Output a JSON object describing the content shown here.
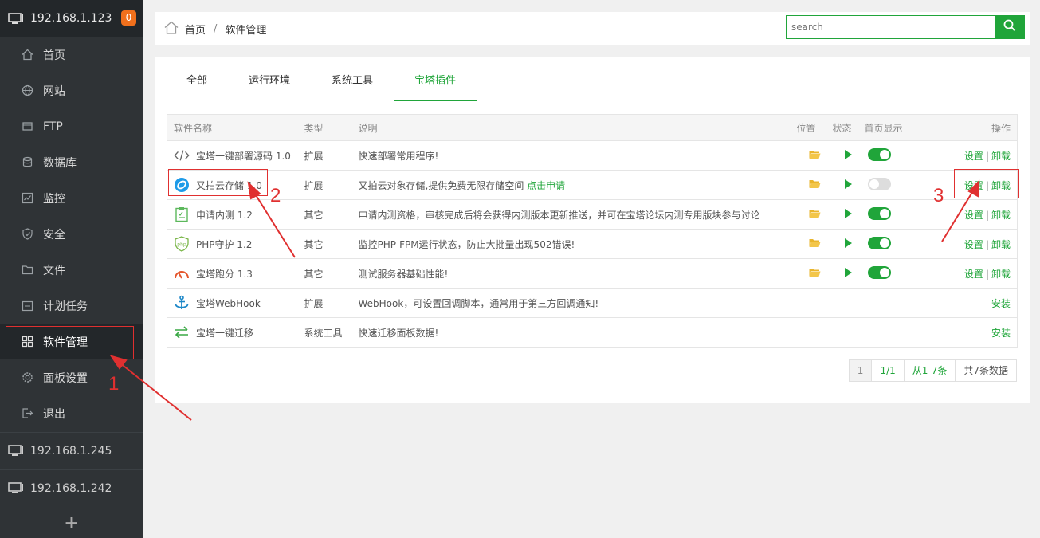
{
  "sidebar": {
    "server": "192.168.1.123",
    "badge": "0",
    "items": [
      {
        "label": "首页",
        "icon": "home-icon"
      },
      {
        "label": "网站",
        "icon": "globe-icon"
      },
      {
        "label": "FTP",
        "icon": "ftp-icon"
      },
      {
        "label": "数据库",
        "icon": "database-icon"
      },
      {
        "label": "监控",
        "icon": "monitor-chart-icon"
      },
      {
        "label": "安全",
        "icon": "shield-icon"
      },
      {
        "label": "文件",
        "icon": "folder-icon"
      },
      {
        "label": "计划任务",
        "icon": "calendar-icon"
      },
      {
        "label": "软件管理",
        "icon": "grid-icon"
      },
      {
        "label": "面板设置",
        "icon": "gear-icon"
      },
      {
        "label": "退出",
        "icon": "logout-icon"
      }
    ],
    "other_servers": [
      "192.168.1.245",
      "192.168.1.242"
    ],
    "add_label": "+"
  },
  "breadcrumb": {
    "home": "首页",
    "sep": "/",
    "current": "软件管理"
  },
  "search": {
    "placeholder": "search"
  },
  "tabs": [
    "全部",
    "运行环境",
    "系统工具",
    "宝塔插件"
  ],
  "table": {
    "headers": {
      "name": "软件名称",
      "type": "类型",
      "desc": "说明",
      "pos": "位置",
      "status": "状态",
      "show": "首页显示",
      "op": "操作"
    },
    "rows": [
      {
        "name": "宝塔一键部署源码 1.0",
        "icon": "code-icon",
        "type": "扩展",
        "desc": "快速部署常用程序!",
        "link": "",
        "installed": true,
        "show": true,
        "op1": "设置",
        "op2": "卸载"
      },
      {
        "name": "又拍云存储 1.0",
        "icon": "upyun-icon",
        "type": "扩展",
        "desc": "又拍云对象存储,提供免费无限存储空间",
        "link": "点击申请",
        "installed": true,
        "show": false,
        "op1": "设置",
        "op2": "卸载"
      },
      {
        "name": "申请内测 1.2",
        "icon": "clipboard-icon",
        "type": "其它",
        "desc": "申请内测资格，审核完成后将会获得内测版本更新推送，并可在宝塔论坛内测专用版块参与讨论",
        "link": "",
        "installed": true,
        "show": true,
        "op1": "设置",
        "op2": "卸载"
      },
      {
        "name": "PHP守护 1.2",
        "icon": "php-shield-icon",
        "type": "其它",
        "desc": "监控PHP-FPM运行状态，防止大批量出现502错误!",
        "link": "",
        "installed": true,
        "show": true,
        "op1": "设置",
        "op2": "卸载"
      },
      {
        "name": "宝塔跑分 1.3",
        "icon": "speedometer-icon",
        "type": "其它",
        "desc": "测试服务器基础性能!",
        "link": "",
        "installed": true,
        "show": true,
        "op1": "设置",
        "op2": "卸载"
      },
      {
        "name": "宝塔WebHook",
        "icon": "anchor-icon",
        "type": "扩展",
        "desc": "WebHook，可设置回调脚本，通常用于第三方回调通知!",
        "link": "",
        "installed": false,
        "show": false,
        "op1": "安装",
        "op2": ""
      },
      {
        "name": "宝塔一键迁移",
        "icon": "transfer-icon",
        "type": "系统工具",
        "desc": "快速迁移面板数据!",
        "link": "",
        "installed": false,
        "show": false,
        "op1": "安装",
        "op2": ""
      }
    ]
  },
  "pager": {
    "current": "1",
    "pages": "1/1",
    "range": "从1-7条",
    "total": "共7条数据"
  },
  "annotations": [
    "1",
    "2",
    "3"
  ],
  "colors": {
    "accent": "#20a53a",
    "sidebar": "#2f3336",
    "annotation": "#e03030",
    "badge": "#f0701c"
  }
}
